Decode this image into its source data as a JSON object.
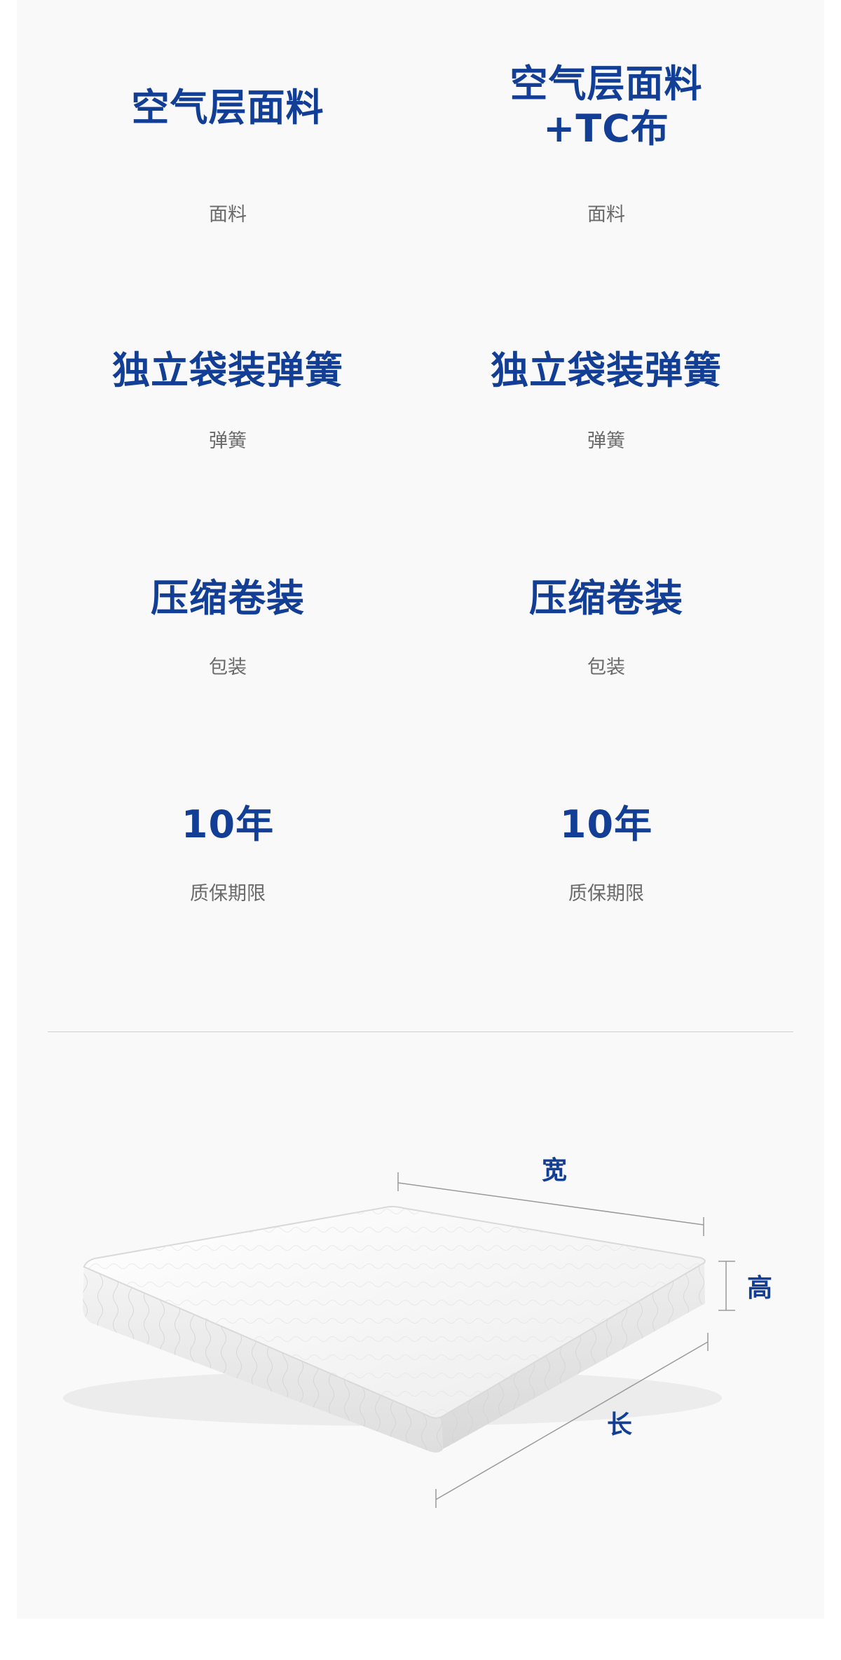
{
  "specs": [
    {
      "value": "空气层面料",
      "label": "面料"
    },
    {
      "value": "空气层面料\n+TC布",
      "label": "面料"
    },
    {
      "value": "独立袋装弹簧",
      "label": "弹簧"
    },
    {
      "value": "独立袋装弹簧",
      "label": "弹簧"
    },
    {
      "value": "压缩卷装",
      "label": "包装"
    },
    {
      "value": "压缩卷装",
      "label": "包装"
    },
    {
      "value": "10年",
      "label": "质保期限"
    },
    {
      "value": "10年",
      "label": "质保期限"
    }
  ],
  "dimensions": {
    "width": "宽",
    "height": "高",
    "length": "长"
  },
  "colors": {
    "accent": "#123e95",
    "label": "#6a6a6a",
    "background": "#f9f9f9"
  }
}
